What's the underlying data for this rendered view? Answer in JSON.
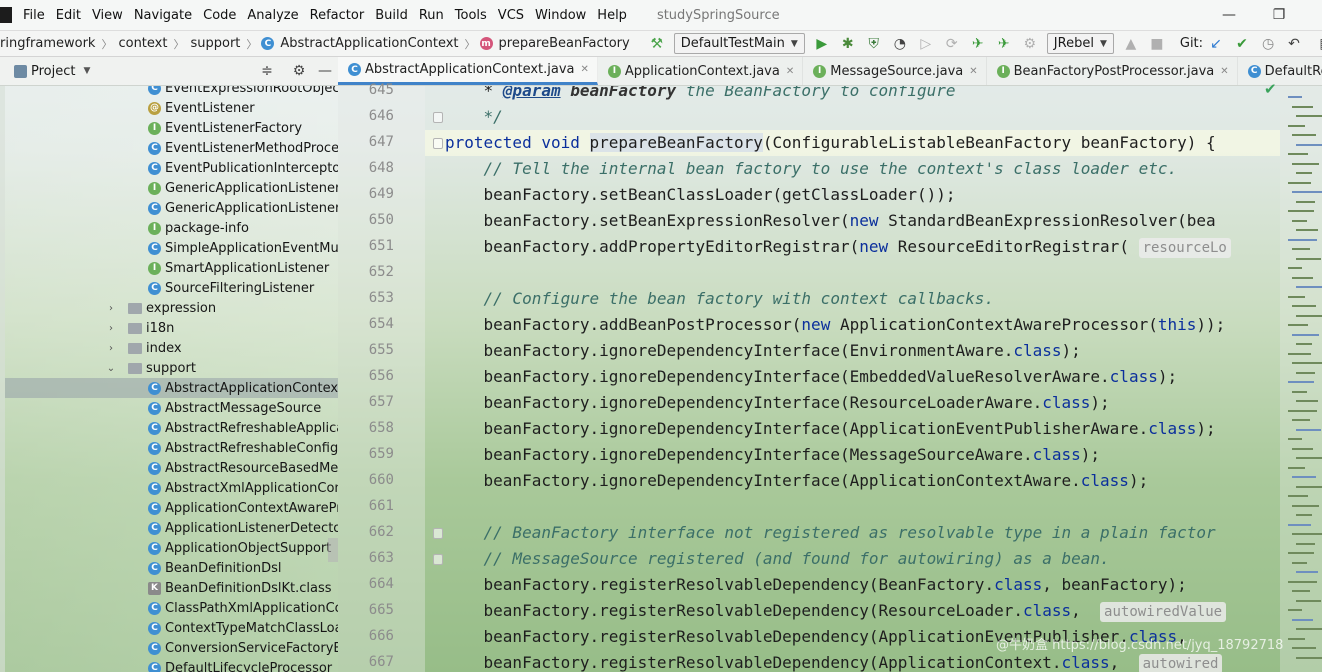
{
  "menubar": {
    "items": [
      {
        "label": "File"
      },
      {
        "label": "Edit"
      },
      {
        "label": "View"
      },
      {
        "label": "Navigate"
      },
      {
        "label": "Code"
      },
      {
        "label": "Analyze"
      },
      {
        "label": "Refactor"
      },
      {
        "label": "Build"
      },
      {
        "label": "Run"
      },
      {
        "label": "Tools"
      },
      {
        "label": "VCS"
      },
      {
        "label": "Window"
      },
      {
        "label": "Help"
      }
    ],
    "project_title": "studySpringSource",
    "minimize_glyph": "—",
    "maximize_glyph": "❐"
  },
  "navbar": {
    "breadcrumbs": [
      "ringframework",
      "context",
      "support",
      "AbstractApplicationContext",
      "prepareBeanFactory"
    ],
    "run_config": "DefaultTestMain",
    "jrebel_label": "JRebel",
    "git_label": "Git:"
  },
  "project_panel": {
    "title": "Project"
  },
  "editor_tabs": [
    {
      "label": "AbstractApplicationContext.java",
      "icon": "C",
      "active": true
    },
    {
      "label": "ApplicationContext.java",
      "icon": "I",
      "active": false
    },
    {
      "label": "MessageSource.java",
      "icon": "I",
      "active": false
    },
    {
      "label": "BeanFactoryPostProcessor.java",
      "icon": "I",
      "active": false
    },
    {
      "label": "DefaultResourceLoad",
      "icon": "C",
      "active": false
    }
  ],
  "tree": [
    {
      "label": "EventExpressionRootObject",
      "icon": "C",
      "kind": "class",
      "level": 2
    },
    {
      "label": "EventListener",
      "icon": "@",
      "kind": "annotation",
      "level": 2
    },
    {
      "label": "EventListenerFactory",
      "icon": "I",
      "kind": "interface",
      "level": 2
    },
    {
      "label": "EventListenerMethodProcesso",
      "icon": "C",
      "kind": "class",
      "level": 2
    },
    {
      "label": "EventPublicationInterceptor",
      "icon": "C",
      "kind": "class",
      "level": 2
    },
    {
      "label": "GenericApplicationListener",
      "icon": "I",
      "kind": "interface",
      "level": 2
    },
    {
      "label": "GenericApplicationListenerAda",
      "icon": "C",
      "kind": "class",
      "level": 2
    },
    {
      "label": "package-info",
      "icon": "I",
      "kind": "interface",
      "level": 2
    },
    {
      "label": "SimpleApplicationEventMultica",
      "icon": "C",
      "kind": "class",
      "level": 2
    },
    {
      "label": "SmartApplicationListener",
      "icon": "I",
      "kind": "interface",
      "level": 2
    },
    {
      "label": "SourceFilteringListener",
      "icon": "C",
      "kind": "class",
      "level": 2
    },
    {
      "label": "expression",
      "icon": "",
      "kind": "folder",
      "level": 1,
      "expanded": false
    },
    {
      "label": "i18n",
      "icon": "",
      "kind": "folder",
      "level": 1,
      "expanded": false
    },
    {
      "label": "index",
      "icon": "",
      "kind": "folder",
      "level": 1,
      "expanded": false
    },
    {
      "label": "support",
      "icon": "",
      "kind": "folder",
      "level": 1,
      "expanded": true
    },
    {
      "label": "AbstractApplicationContext",
      "icon": "C",
      "kind": "class",
      "level": 2,
      "selected": true
    },
    {
      "label": "AbstractMessageSource",
      "icon": "C",
      "kind": "class",
      "level": 2
    },
    {
      "label": "AbstractRefreshableApplicati",
      "icon": "C",
      "kind": "class",
      "level": 2
    },
    {
      "label": "AbstractRefreshableConfigApp",
      "icon": "C",
      "kind": "class",
      "level": 2
    },
    {
      "label": "AbstractResourceBasedMessa",
      "icon": "C",
      "kind": "class",
      "level": 2
    },
    {
      "label": "AbstractXmlApplicationContex",
      "icon": "C",
      "kind": "class",
      "level": 2
    },
    {
      "label": "ApplicationContextAwareProce",
      "icon": "C",
      "kind": "class",
      "level": 2
    },
    {
      "label": "ApplicationListenerDetector",
      "icon": "C",
      "kind": "class",
      "level": 2
    },
    {
      "label": "ApplicationObjectSupport",
      "icon": "C",
      "kind": "class",
      "level": 2
    },
    {
      "label": "BeanDefinitionDsl",
      "icon": "C",
      "kind": "class",
      "level": 2
    },
    {
      "label": "BeanDefinitionDslKt.class",
      "icon": "K",
      "kind": "kotlin",
      "level": 2
    },
    {
      "label": "ClassPathXmlApplicationConte",
      "icon": "C",
      "kind": "class",
      "level": 2
    },
    {
      "label": "ContextTypeMatchClassLoade",
      "icon": "C",
      "kind": "class",
      "level": 2
    },
    {
      "label": "ConversionServiceFactoryBear",
      "icon": "C",
      "kind": "class",
      "level": 2
    },
    {
      "label": "DefaultLifecycleProcessor",
      "icon": "C",
      "kind": "class",
      "level": 2
    }
  ],
  "code": {
    "lines": [
      {
        "n": "645",
        "parts": [
          [
            "p",
            "    * "
          ],
          [
            "doctag",
            "@param"
          ],
          [
            "docp",
            " beanFactory"
          ],
          [
            "cm",
            " the BeanFactory to configure"
          ]
        ]
      },
      {
        "n": "646",
        "parts": [
          [
            "cm",
            "    */"
          ]
        ]
      },
      {
        "n": "647",
        "current": true,
        "parts": [
          [
            "kw",
            "protected"
          ],
          [
            "p",
            " "
          ],
          [
            "kw",
            "void"
          ],
          [
            "p",
            " "
          ],
          [
            "hl",
            "prepareBeanFactory"
          ],
          [
            "p",
            "(ConfigurableListableBeanFactory beanFactory) {"
          ]
        ]
      },
      {
        "n": "648",
        "parts": [
          [
            "p",
            "    "
          ],
          [
            "cm",
            "// Tell the internal bean factory to use the context's class loader etc."
          ]
        ]
      },
      {
        "n": "649",
        "parts": [
          [
            "p",
            "    beanFactory.setBeanClassLoader(getClassLoader());"
          ]
        ]
      },
      {
        "n": "650",
        "parts": [
          [
            "p",
            "    beanFactory.setBeanExpressionResolver("
          ],
          [
            "kw",
            "new"
          ],
          [
            "p",
            " StandardBeanExpressionResolver(bea"
          ]
        ]
      },
      {
        "n": "651",
        "parts": [
          [
            "p",
            "    beanFactory.addPropertyEditorRegistrar("
          ],
          [
            "kw",
            "new"
          ],
          [
            "p",
            " ResourceEditorRegistrar( "
          ],
          [
            "hint",
            "resourceLo"
          ]
        ]
      },
      {
        "n": "652",
        "parts": [
          [
            "p",
            ""
          ]
        ]
      },
      {
        "n": "653",
        "parts": [
          [
            "p",
            "    "
          ],
          [
            "cm",
            "// Configure the bean factory with context callbacks."
          ]
        ]
      },
      {
        "n": "654",
        "parts": [
          [
            "p",
            "    beanFactory.addBeanPostProcessor("
          ],
          [
            "kw",
            "new"
          ],
          [
            "p",
            " ApplicationContextAwareProcessor("
          ],
          [
            "kw",
            "this"
          ],
          [
            "p",
            "));"
          ]
        ]
      },
      {
        "n": "655",
        "parts": [
          [
            "p",
            "    beanFactory.ignoreDependencyInterface(EnvironmentAware."
          ],
          [
            "kw",
            "class"
          ],
          [
            "p",
            ");"
          ]
        ]
      },
      {
        "n": "656",
        "parts": [
          [
            "p",
            "    beanFactory.ignoreDependencyInterface(EmbeddedValueResolverAware."
          ],
          [
            "kw",
            "class"
          ],
          [
            "p",
            ");"
          ]
        ]
      },
      {
        "n": "657",
        "parts": [
          [
            "p",
            "    beanFactory.ignoreDependencyInterface(ResourceLoaderAware."
          ],
          [
            "kw",
            "class"
          ],
          [
            "p",
            ");"
          ]
        ]
      },
      {
        "n": "658",
        "parts": [
          [
            "p",
            "    beanFactory.ignoreDependencyInterface(ApplicationEventPublisherAware."
          ],
          [
            "kw",
            "class"
          ],
          [
            "p",
            ");"
          ]
        ]
      },
      {
        "n": "659",
        "parts": [
          [
            "p",
            "    beanFactory.ignoreDependencyInterface(MessageSourceAware."
          ],
          [
            "kw",
            "class"
          ],
          [
            "p",
            ");"
          ]
        ]
      },
      {
        "n": "660",
        "parts": [
          [
            "p",
            "    beanFactory.ignoreDependencyInterface(ApplicationContextAware."
          ],
          [
            "kw",
            "class"
          ],
          [
            "p",
            ");"
          ]
        ]
      },
      {
        "n": "661",
        "parts": [
          [
            "p",
            ""
          ]
        ]
      },
      {
        "n": "662",
        "parts": [
          [
            "p",
            "    "
          ],
          [
            "cm",
            "// BeanFactory interface not registered as resolvable type in a plain factor"
          ]
        ]
      },
      {
        "n": "663",
        "parts": [
          [
            "p",
            "    "
          ],
          [
            "cm",
            "// MessageSource registered (and found for autowiring) as a bean."
          ]
        ]
      },
      {
        "n": "664",
        "parts": [
          [
            "p",
            "    beanFactory.registerResolvableDependency(BeanFactory."
          ],
          [
            "kw",
            "class"
          ],
          [
            "p",
            ", beanFactory);"
          ]
        ]
      },
      {
        "n": "665",
        "parts": [
          [
            "p",
            "    beanFactory.registerResolvableDependency(ResourceLoader."
          ],
          [
            "kw",
            "class"
          ],
          [
            "p",
            ",  "
          ],
          [
            "hint",
            "autowiredValue"
          ]
        ]
      },
      {
        "n": "666",
        "parts": [
          [
            "p",
            "    beanFactory.registerResolvableDependency(ApplicationEventPublisher."
          ],
          [
            "kw",
            "class"
          ],
          [
            "p",
            ","
          ]
        ]
      },
      {
        "n": "667",
        "parts": [
          [
            "p",
            "    beanFactory.registerResolvableDependency(ApplicationContext."
          ],
          [
            "kw",
            "class"
          ],
          [
            "p",
            ",  "
          ],
          [
            "hint",
            "autowired"
          ]
        ]
      }
    ]
  },
  "watermark": "@牛奶盒 https://blog.csdn.net/jyq_18792718",
  "colors": {
    "keyword": "#0b2f9c",
    "comment": "#3b6f68",
    "selection": "#96a0a8",
    "accent": "#4083c9"
  }
}
